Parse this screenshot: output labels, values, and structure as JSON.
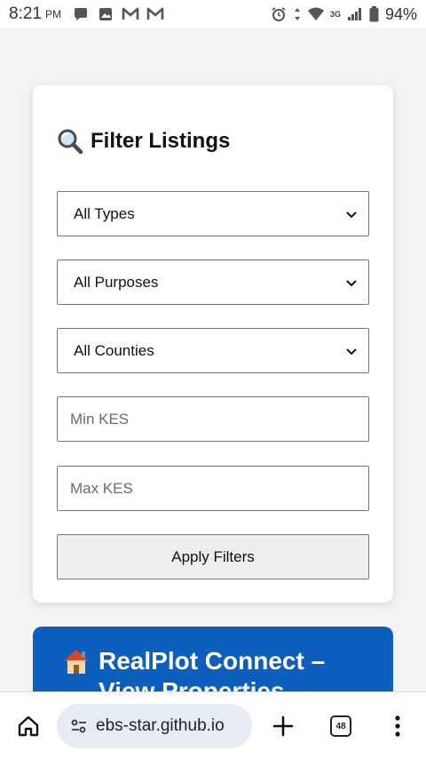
{
  "status_bar": {
    "time": "8:21",
    "ampm": "PM",
    "network": "3G",
    "battery": "94%",
    "icons_left": [
      "chat-bubble-icon",
      "image-icon",
      "gmail-icon",
      "gmail-icon"
    ],
    "icons_right": [
      "alarm-icon",
      "data-arrows-icon",
      "wifi-icon",
      "signal-icon",
      "battery-icon"
    ]
  },
  "filter": {
    "title": "Filter Listings",
    "title_icon": "magnifier-icon",
    "type_select": "All Types",
    "purpose_select": "All Purposes",
    "county_select": "All Counties",
    "min_placeholder": "Min KES",
    "max_placeholder": "Max KES",
    "apply_label": "Apply Filters"
  },
  "hero": {
    "icon": "house-icon",
    "title": "RealPlot Connect – View Properties"
  },
  "browser": {
    "url": "ebs-star.github.io",
    "tab_count": "48"
  },
  "colors": {
    "hero_bg": "#0d5fbd",
    "page_bg": "#f3f3f3",
    "url_pill_bg": "#e7ebf3"
  }
}
